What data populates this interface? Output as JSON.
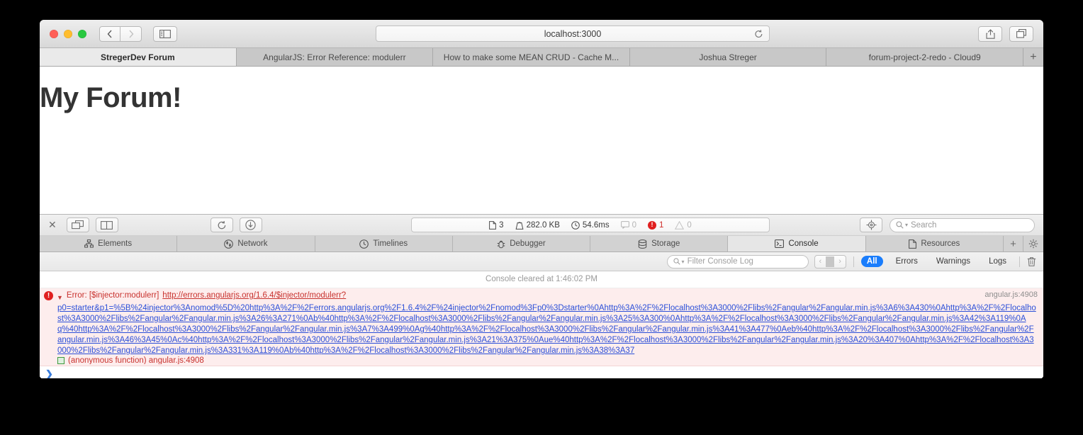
{
  "window": {
    "traffic_lights": [
      "close-red",
      "minimize-yellow",
      "zoom-green"
    ],
    "nav": {
      "back_label": "‹",
      "forward_label": "›"
    },
    "address": {
      "value": "localhost:3000",
      "reload_icon": "reload-icon"
    },
    "share_icon": "share-icon",
    "tab-overview_icon": "tab-overview-icon",
    "sidebar_icon": "sidebar-icon"
  },
  "browser_tabs": {
    "items": [
      {
        "label": "StregerDev Forum",
        "active": true
      },
      {
        "label": "AngularJS: Error Reference: modulerr",
        "active": false
      },
      {
        "label": "How to make some MEAN CRUD - Cache M...",
        "active": false
      },
      {
        "label": "Joshua Streger",
        "active": false
      },
      {
        "label": "forum-project-2-redo - Cloud9",
        "active": false
      }
    ],
    "new_tab_label": "+"
  },
  "page": {
    "heading": "My Forum!"
  },
  "devtools": {
    "close_label": "✕",
    "dock_icon": "dock-window-icon",
    "split_icon": "split-pane-icon",
    "reload_icon": "reload-page-icon",
    "download_icon": "download-icon",
    "status": {
      "resources_count": "3",
      "transfer_size": "282.0 KB",
      "load_time": "54.6ms",
      "messages_count": "0",
      "errors_count": "1",
      "warnings_count": "0"
    },
    "inspect_icon": "node-inspect-icon",
    "search": {
      "placeholder": "Search",
      "icon": "search-icon"
    },
    "tabs": [
      {
        "label": "Elements",
        "icon": "elements-icon",
        "active": false
      },
      {
        "label": "Network",
        "icon": "network-icon",
        "active": false
      },
      {
        "label": "Timelines",
        "icon": "timelines-icon",
        "active": false
      },
      {
        "label": "Debugger",
        "icon": "debugger-bug-icon",
        "active": false
      },
      {
        "label": "Storage",
        "icon": "storage-icon",
        "active": false
      },
      {
        "label": "Console",
        "icon": "console-icon",
        "active": true
      },
      {
        "label": "Resources",
        "icon": "resources-icon",
        "active": false
      }
    ],
    "tabs_add_label": "+",
    "tabs_gear_icon": "gear-icon",
    "filter": {
      "placeholder": "Filter Console Log",
      "icon": "search-icon",
      "prev_label": "‹",
      "next_label": "›",
      "buttons": [
        {
          "label": "All",
          "active": true
        },
        {
          "label": "Errors",
          "active": false
        },
        {
          "label": "Warnings",
          "active": false
        },
        {
          "label": "Logs",
          "active": false
        }
      ],
      "clear_icon": "trash-icon"
    }
  },
  "console": {
    "cleared_message": "Console cleared at 1:46:02 PM",
    "entry": {
      "badge": "!",
      "disclosure": "▼",
      "prefix": "Error: [$injector:modulerr] ",
      "link": "http://errors.angularjs.org/1.6.4/$injector/modulerr?",
      "source": "angular.js:4908",
      "url_body": "p0=starter&p1=%5B%24injector%3Anomod%5D%20http%3A%2F%2Ferrors.angularjs.org%2F1.6.4%2F%24injector%2Fnomod%3Fp0%3Dstarter%0Ahttp%3A%2F%2Flocalhost%3A3000%2Flibs%2Fangular%2Fangular.min.js%3A6%3A430%0Ahttp%3A%2F%2Flocalhost%3A3000%2Flibs%2Fangular%2Fangular.min.js%3A26%3A271%0Ab%40http%3A%2F%2Flocalhost%3A3000%2Flibs%2Fangular%2Fangular.min.js%3A25%3A300%0Ahttp%3A%2F%2Flocalhost%3A3000%2Flibs%2Fangular%2Fangular.min.js%3A42%3A119%0Aq%40http%3A%2F%2Flocalhost%3A3000%2Flibs%2Fangular%2Fangular.min.js%3A7%3A499%0Ag%40http%3A%2F%2Flocalhost%3A3000%2Flibs%2Fangular%2Fangular.min.js%3A41%3A477%0Aeb%40http%3A%2F%2Flocalhost%3A3000%2Flibs%2Fangular%2Fangular.min.js%3A46%3A45%0Ac%40http%3A%2F%2Flocalhost%3A3000%2Flibs%2Fangular%2Fangular.min.js%3A21%3A375%0Aue%40http%3A%2F%2Flocalhost%3A3000%2Flibs%2Fangular%2Fangular.min.js%3A20%3A407%0Ahttp%3A%2F%2Flocalhost%3A3000%2Flibs%2Fangular%2Fangular.min.js%3A331%3A119%0Ab%40http%3A%2F%2Flocalhost%3A3000%2Flibs%2Fangular%2Fangular.min.js%3A38%3A37",
      "stack_line": "(anonymous function)   angular.js:4908"
    },
    "prompt_symbol": "❯"
  },
  "colors": {
    "error_red": "#c8322e",
    "error_badge": "#e02020",
    "link_blue": "#2b4fd8",
    "accent_blue": "#1a7dfc",
    "error_bg": "#fdeded"
  }
}
